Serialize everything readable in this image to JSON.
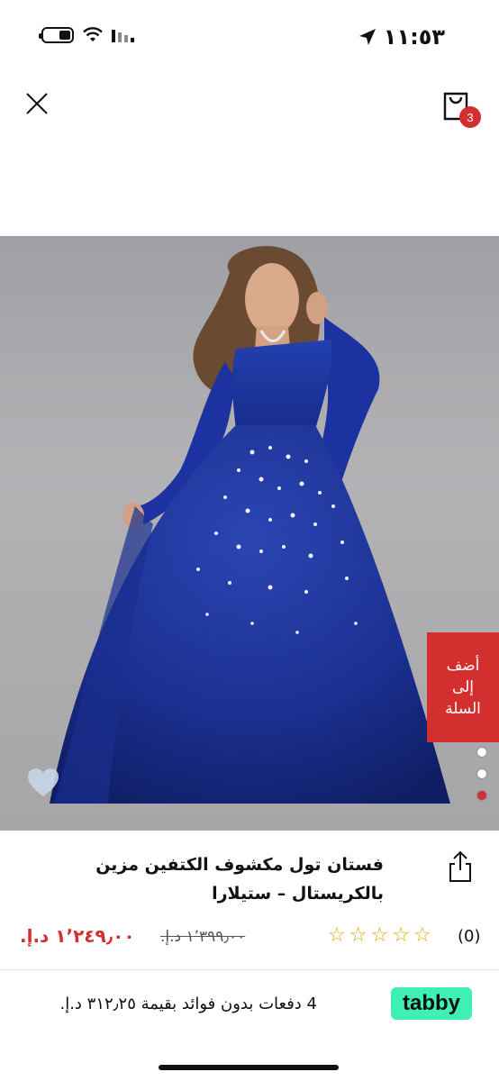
{
  "status_bar": {
    "time": "١١:٥٣"
  },
  "header": {
    "cart_count": "3"
  },
  "product": {
    "add_to_cart_label": "أضف\nإلى\nالسلة",
    "title": "فستان تول مكشوف الكتفين مزين بالكريستال – ستيلارا",
    "price_current": "١٬٢٤٩٫٠٠ د.إ.",
    "price_original": "١٬٣٩٩٫٠٠ د.إ.",
    "rating_count": "(0)",
    "stars": 0,
    "image_dots": 5,
    "active_dot_index": 4
  },
  "tabby": {
    "logo": "tabby",
    "text": "4 دفعات بدون فوائد بقيمة ٣١٢٫٢٥ د.إ."
  },
  "colors": {
    "accent": "#d32f2f",
    "tabby": "#3ef0b3",
    "dress": "#1a2f8f"
  }
}
